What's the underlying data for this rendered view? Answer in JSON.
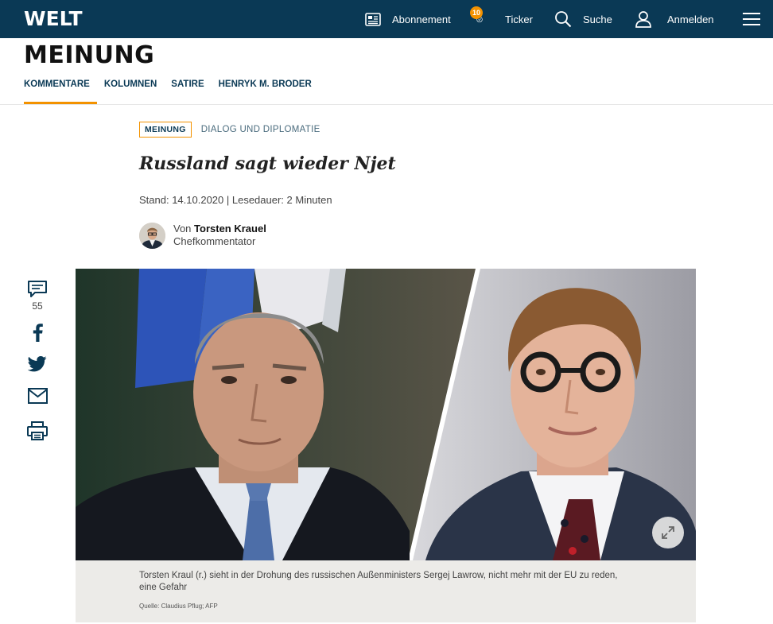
{
  "header": {
    "logo": "WELT",
    "nav": {
      "abonnement": "Abonnement",
      "ticker": "Ticker",
      "ticker_badge": "10",
      "suche": "Suche",
      "anmelden": "Anmelden"
    },
    "bg_color": "#0a3955",
    "accent_color": "#f39200"
  },
  "section": {
    "title": "MEINUNG",
    "subnav": [
      "KOMMENTARE",
      "KOLUMNEN",
      "SATIRE",
      "HENRYK M. BRODER"
    ],
    "active_subnav": "KOMMENTARE"
  },
  "article": {
    "kicker": "MEINUNG",
    "topic": "DIALOG UND DIPLOMATIE",
    "headline": "Russland sagt wieder Njet",
    "meta": "Stand: 14.10.2020 | Lesedauer: 2 Minuten",
    "author": {
      "prefix": "Von",
      "name": "Torsten Krauel",
      "role": "Chefkommentator"
    },
    "image": {
      "caption": "Torsten Kraul (r.) sieht in der Drohung des russischen Außenministers Sergej Lawrow, nicht mehr mit der EU zu reden, eine Gefahr",
      "source": "Quelle: Claudius Pflug; AFP"
    }
  },
  "sidebar": {
    "comment_count": "55",
    "icons": [
      "comment-icon",
      "facebook-icon",
      "twitter-icon",
      "mail-icon",
      "print-icon"
    ]
  }
}
